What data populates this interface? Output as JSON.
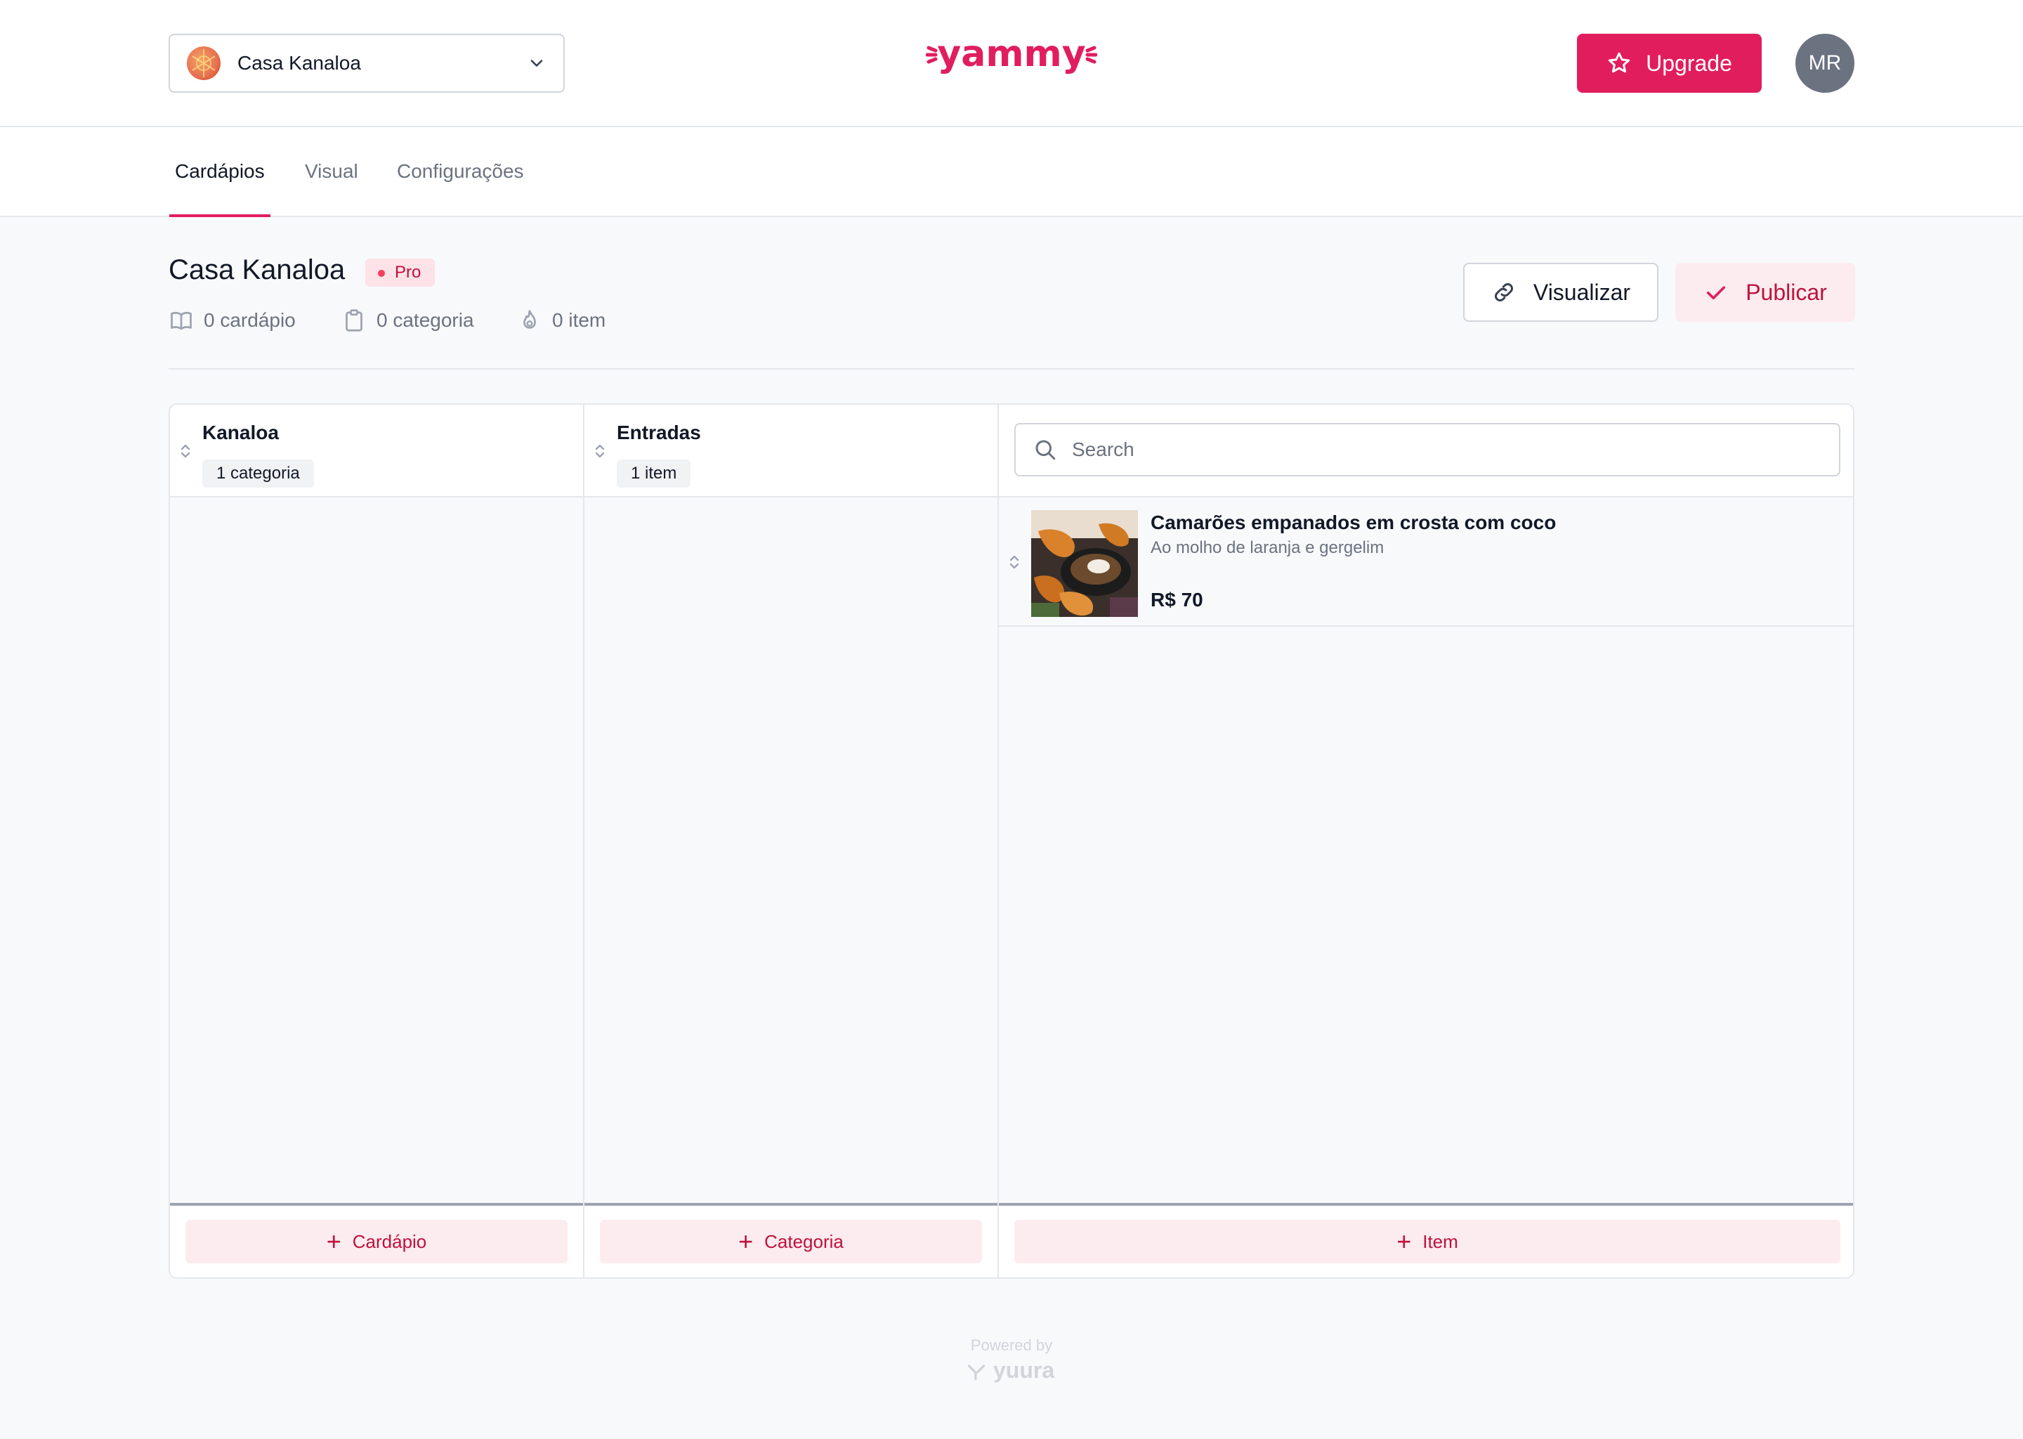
{
  "header": {
    "store_select": {
      "value": "Casa Kanaloa"
    },
    "brand": "yammy",
    "upgrade_label": "Upgrade",
    "avatar_initials": "MR"
  },
  "nav": {
    "tabs": [
      {
        "label": "Cardápios",
        "active": true
      },
      {
        "label": "Visual",
        "active": false
      },
      {
        "label": "Configurações",
        "active": false
      }
    ]
  },
  "page": {
    "title": "Casa Kanaloa",
    "badge": "Pro",
    "stats": {
      "menus": "0 cardápio",
      "categories": "0 categoria",
      "items": "0 item"
    },
    "view_label": "Visualizar",
    "publish_label": "Publicar"
  },
  "board": {
    "menus_column": {
      "title": "Kanaloa",
      "count": "1 categoria",
      "add_label": "Cardápio"
    },
    "categories_column": {
      "title": "Entradas",
      "count": "1 item",
      "add_label": "Categoria"
    },
    "items_column": {
      "search_placeholder": "Search",
      "items": [
        {
          "name": "Camarões empanados em crosta com coco",
          "description": "Ao molho de laranja e gergelim",
          "price": "R$ 70"
        }
      ],
      "add_label": "Item"
    }
  },
  "footer": {
    "powered_by": "Powered by",
    "brand": "yuura"
  },
  "colors": {
    "accent": "#e11d5e",
    "accent_soft": "#fdecef",
    "text": "#111827",
    "muted": "#6b7280"
  }
}
